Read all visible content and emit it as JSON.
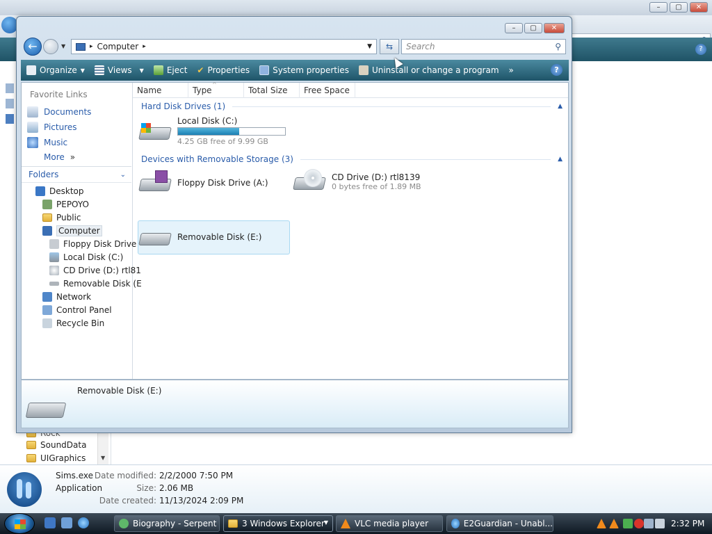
{
  "explorer": {
    "address": "Computer",
    "search_placeholder": "Search",
    "toolbar": {
      "organize": "Organize",
      "views": "Views",
      "eject": "Eject",
      "properties": "Properties",
      "system_properties": "System properties",
      "uninstall": "Uninstall or change a program",
      "more": "»",
      "help": "?"
    },
    "favorite_links_title": "Favorite Links",
    "favorite_links": [
      "Documents",
      "Pictures",
      "Music",
      "More"
    ],
    "folders_title": "Folders",
    "tree": [
      {
        "label": "Desktop"
      },
      {
        "label": "PEPOYO"
      },
      {
        "label": "Public"
      },
      {
        "label": "Computer"
      },
      {
        "label": "Floppy Disk Drive"
      },
      {
        "label": "Local Disk (C:)"
      },
      {
        "label": "CD Drive (D:) rtl81"
      },
      {
        "label": "Removable Disk (E"
      },
      {
        "label": "Network"
      },
      {
        "label": "Control Panel"
      },
      {
        "label": "Recycle Bin"
      }
    ],
    "columns": [
      "Name",
      "Type",
      "Total Size",
      "Free Space"
    ],
    "groups": {
      "hard_disk": "Hard Disk Drives (1)",
      "removable": "Devices with Removable Storage (3)"
    },
    "drives": {
      "c": {
        "name": "Local Disk (C:)",
        "free": "4.25 GB free of 9.99 GB",
        "used_fraction": 0.574
      },
      "a": {
        "name": "Floppy Disk Drive (A:)"
      },
      "d": {
        "name": "CD Drive (D:) rtl8139",
        "free": "0 bytes free of 1.89 MB"
      },
      "e": {
        "name": "Removable Disk (E:)"
      }
    },
    "info_pane": {
      "name": "Removable Disk (E:)"
    }
  },
  "background": {
    "list": [
      "Rock",
      "SoundData",
      "UIGraphics"
    ],
    "details": {
      "name": "Sims.exe",
      "type": "Application",
      "modified_label": "Date modified:",
      "modified": "2/2/2000 7:50 PM",
      "size_label": "Size:",
      "size": "2.06 MB",
      "created_label": "Date created:",
      "created": "11/13/2024 2:09 PM"
    }
  },
  "taskbar": {
    "buttons": [
      "Biography - Serpent",
      "3 Windows Explorer",
      "VLC media player",
      "E2Guardian - Unabl..."
    ],
    "clock": "2:32 PM"
  }
}
